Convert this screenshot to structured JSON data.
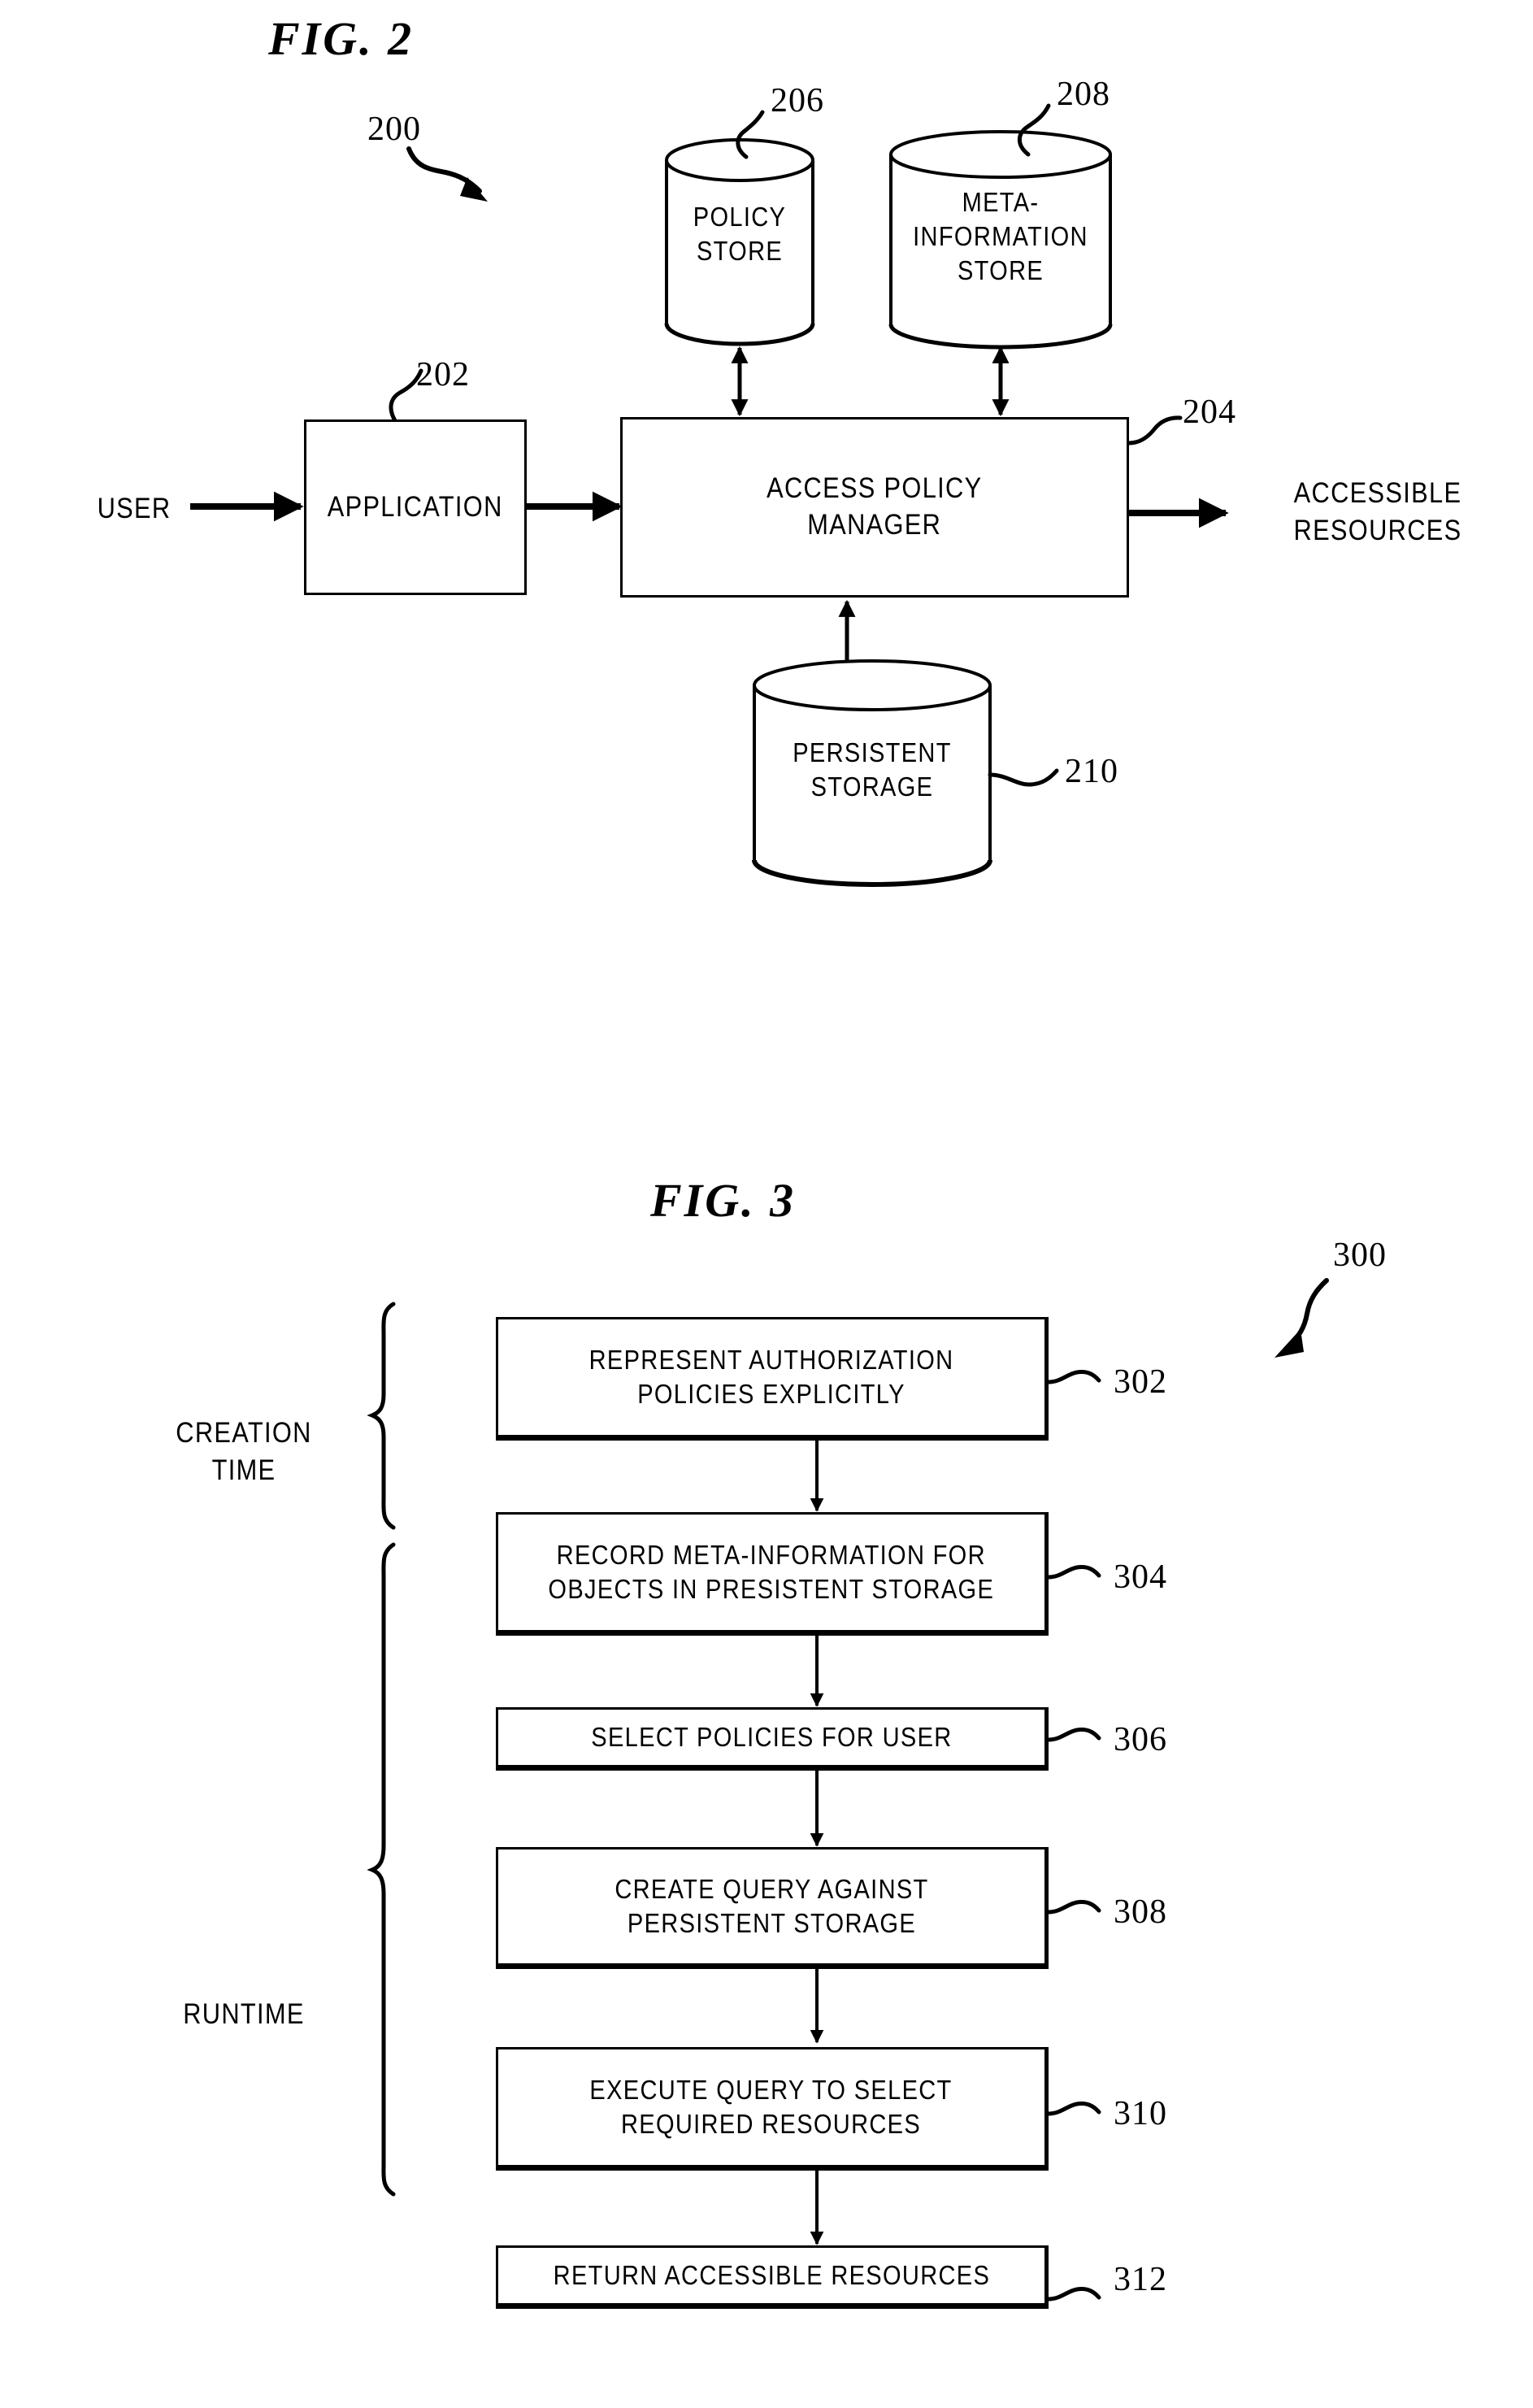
{
  "figures": [
    {
      "id": "fig2",
      "title": "FIG.  2",
      "ref": "200",
      "nodes": {
        "user_label": "USER",
        "application": "APPLICATION",
        "application_ref": "202",
        "access_policy_manager": "ACCESS POLICY\nMANAGER",
        "access_policy_manager_ref": "204",
        "policy_store": "POLICY\nSTORE",
        "policy_store_ref": "206",
        "meta_information_store": "META-\nINFORMATION\nSTORE",
        "meta_information_store_ref": "208",
        "persistent_storage": "PERSISTENT\nSTORAGE",
        "persistent_storage_ref": "210",
        "accessible_resources_label": "ACCESSIBLE\nRESOURCES"
      }
    },
    {
      "id": "fig3",
      "title": "FIG.  3",
      "ref": "300",
      "phases": [
        {
          "label": "CREATION\nTIME"
        },
        {
          "label": "RUNTIME"
        }
      ],
      "steps": [
        {
          "text": "REPRESENT AUTHORIZATION\nPOLICIES EXPLICITLY",
          "ref": "302"
        },
        {
          "text": "RECORD META-INFORMATION FOR\nOBJECTS IN PRESISTENT STORAGE",
          "ref": "304"
        },
        {
          "text": "SELECT POLICIES FOR USER",
          "ref": "306"
        },
        {
          "text": "CREATE QUERY AGAINST\nPERSISTENT STORAGE",
          "ref": "308"
        },
        {
          "text": "EXECUTE QUERY TO SELECT\nREQUIRED RESOURCES",
          "ref": "310"
        },
        {
          "text": "RETURN ACCESSIBLE RESOURCES",
          "ref": "312"
        }
      ]
    }
  ],
  "colors": {
    "ink": "#000000",
    "paper": "#ffffff"
  }
}
